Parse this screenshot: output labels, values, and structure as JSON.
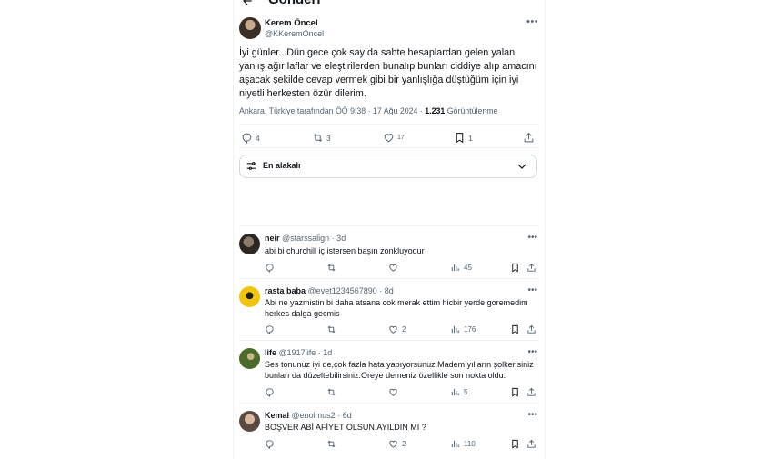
{
  "header": {
    "title": "Gönderi"
  },
  "tweet": {
    "author_name": "Kerem Öncel",
    "author_handle": "@KKeremOncel",
    "text": "İyi günler...Dün gece çok sayıda sahte hesaplardan gelen yalan yanlış ağır laflar ve eleştirilerden bunalıp bunları ciddiye alıp amacını aşacak şekilde cevap vermek gibi bir yanlışlığa düştüğüm için iyi niyetli herkesten özür dilerim.",
    "location_time": "Ankara, Türkiye tarafından ÖÖ 9:38 · 17 Ağu 2024 · ",
    "views": "1.231",
    "views_label": " Görüntülenme",
    "stats": {
      "replies": "4",
      "reposts": "3",
      "likes": "17",
      "bookmarks": "1"
    }
  },
  "sort": {
    "label": "En alakalı"
  },
  "replies": [
    {
      "name": "neir",
      "handle": "@starssalign · 3d",
      "text": "abi bi churchill iç istersen başın zonkluyodur",
      "views": "45",
      "likes": ""
    },
    {
      "name": "rasta baba",
      "handle": "@evet1234567890 · 8d",
      "text": "Abi ne yazmistin bi daha atsana cok merak ettim hicbir yerde goremedim herkes dalga gecmis",
      "views": "176",
      "likes": "2"
    },
    {
      "name": "life",
      "handle": "@1917life · 1d",
      "text": "Ses tonunuz iyi de,çok fazla hata yapıyorsunuz.Madem yılların şolkerisiniz bunları da düzeltebilirsiniz.Oreye demeniz özellikle son nokta oldu.",
      "views": "5",
      "likes": ""
    },
    {
      "name": "Kemal",
      "handle": "@enolmus2 · 6d",
      "text": "BOŞVER ABİ AFİYET OLSUN,AYILDIN MI ?",
      "views": "110",
      "likes": "2"
    }
  ],
  "colors": {
    "text": "#0f1419",
    "muted": "#536471",
    "border": "#eff3f4"
  },
  "icons": [
    "back-arrow-icon",
    "more-icon",
    "reply-icon",
    "repost-icon",
    "like-icon",
    "bookmark-icon",
    "share-icon",
    "sort-icon",
    "chevron-down-icon",
    "views-icon"
  ]
}
